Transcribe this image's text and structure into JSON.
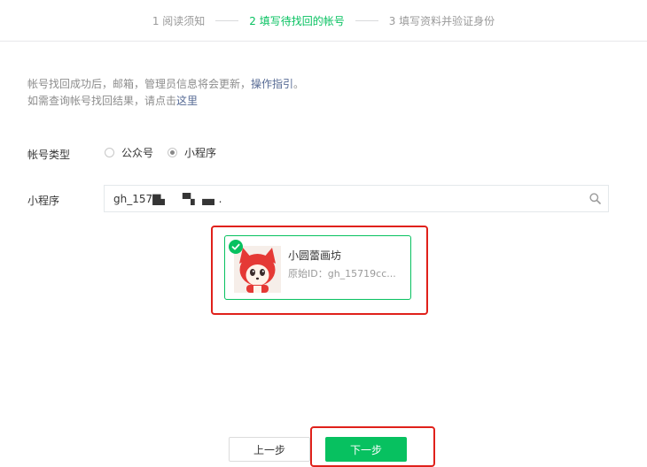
{
  "steps": [
    {
      "label": "1 阅读须知",
      "active": false
    },
    {
      "label": "2 填写待找回的帐号",
      "active": true
    },
    {
      "label": "3 填写资料并验证身份",
      "active": false
    }
  ],
  "notice": {
    "line1_text": "帐号找回成功后，邮箱，管理员信息将会更新，",
    "line1_link": "操作指引",
    "line1_end": "。",
    "line2_text": "如需查询帐号找回结果，请点击",
    "line2_link": "这里"
  },
  "account_type": {
    "label": "帐号类型",
    "options": [
      {
        "label": "公众号",
        "checked": false
      },
      {
        "label": "小程序",
        "checked": true
      }
    ]
  },
  "miniprogram_field": {
    "label": "小程序",
    "value": "gh_157▇▖    ▀▖ ▄▖.",
    "search_icon": "search-icon"
  },
  "result": {
    "name": "小圆蕾画坊",
    "original_id": "原始ID：gh_15719cc...",
    "selected": true
  },
  "buttons": {
    "prev": "上一步",
    "next": "下一步"
  },
  "colors": {
    "accent": "#07c160",
    "link": "#576b95",
    "highlight_frame": "#e0211b"
  }
}
